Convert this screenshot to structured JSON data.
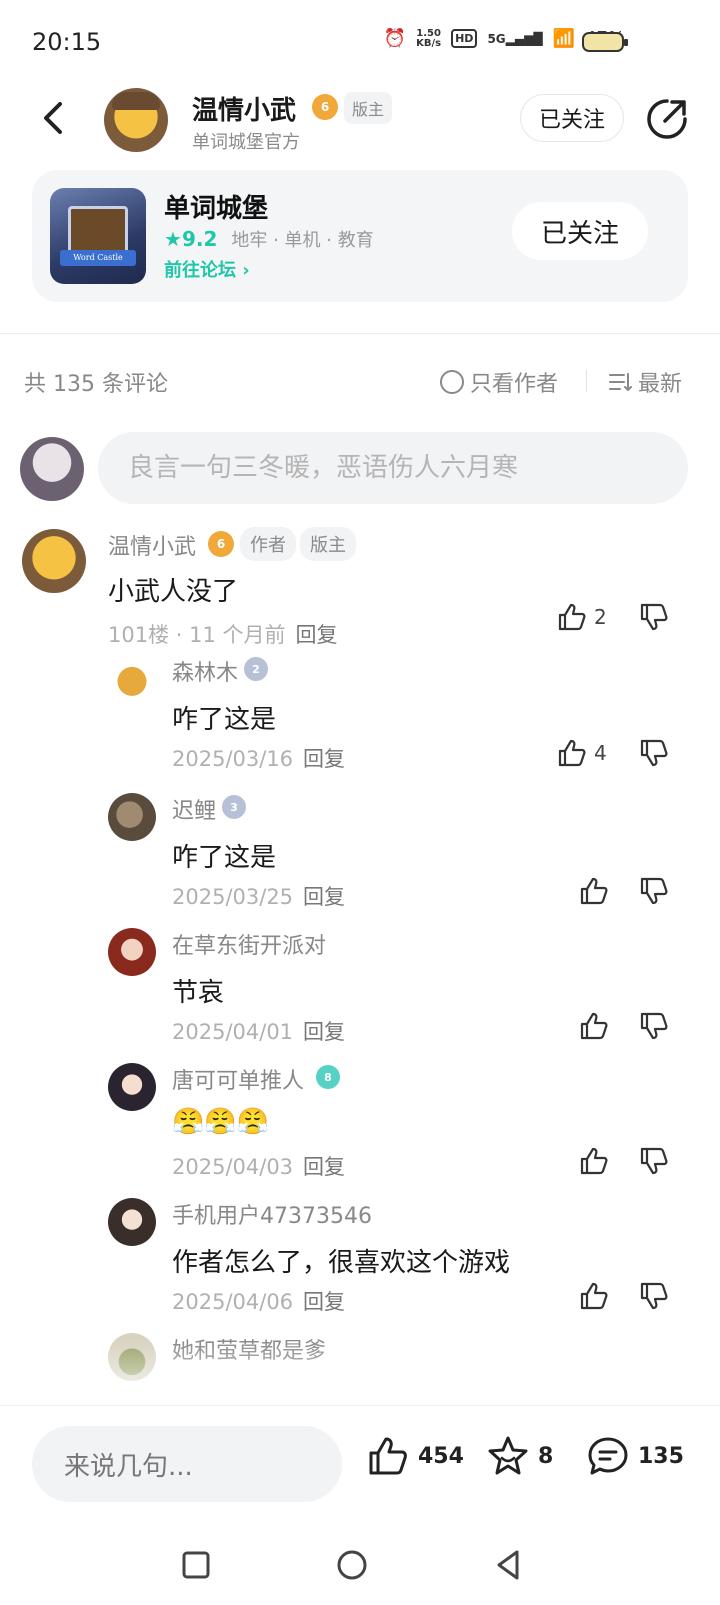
{
  "status_bar": {
    "time": "20:15",
    "net_speed_value": "1.50",
    "net_speed_unit": "KB/s",
    "hd": "HD",
    "signal": "5G",
    "battery": "47%"
  },
  "header": {
    "author_name": "温情小武",
    "author_level": "6",
    "moderator_tag": "版主",
    "author_subtitle": "单词城堡官方",
    "follow_label": "已关注"
  },
  "game_card": {
    "icon_caption": "Word Castle",
    "title": "单词城堡",
    "rating": "9.2",
    "tags": "地牢 · 单机 · 教育",
    "forum_link": "前往论坛",
    "follow_label": "已关注"
  },
  "comments_header": {
    "count_label": "共 135 条评论",
    "author_only": "只看作者",
    "sort": "最新"
  },
  "comment_input": {
    "placeholder": "良言一句三冬暖，恶语伤人六月寒"
  },
  "main_comment": {
    "name": "温情小武",
    "level": "6",
    "tag_author": "作者",
    "tag_mod": "版主",
    "text": "小武人没了",
    "meta": "101楼 · 11 个月前",
    "reply": "回复",
    "likes": "2"
  },
  "replies": [
    {
      "name": "森林木",
      "level": "2",
      "text": "咋了这是",
      "date": "2025/03/16",
      "reply": "回复",
      "likes": "4"
    },
    {
      "name": "迟鲤",
      "level": "3",
      "text": "咋了这是",
      "date": "2025/03/25",
      "reply": "回复",
      "likes": ""
    },
    {
      "name": "在草东街开派对",
      "level": "",
      "text": "节哀",
      "date": "2025/04/01",
      "reply": "回复",
      "likes": ""
    },
    {
      "name": "唐可可单推人",
      "level": "8",
      "text": "😤😤😤",
      "date": "2025/04/03",
      "reply": "回复",
      "likes": ""
    },
    {
      "name": "手机用户47373546",
      "level": "",
      "text": "作者怎么了，很喜欢这个游戏",
      "date": "2025/04/06",
      "reply": "回复",
      "likes": ""
    },
    {
      "name": "她和萤草都是爹"
    }
  ],
  "bottom_bar": {
    "say_placeholder": "来说几句...",
    "likes": "454",
    "favorites": "8",
    "comments": "135"
  },
  "colors": {
    "accent": "#1fc7a8",
    "level_gold": "#f0a83a",
    "level_gray": "#b8c0d8",
    "level_teal": "#57d0c6"
  },
  "icons": [
    "back-icon",
    "share-icon",
    "star-icon",
    "chevron-right-icon",
    "circle-icon",
    "sort-icon",
    "thumb-up-icon",
    "thumb-down-icon",
    "star-outline-icon",
    "comment-bubble-icon",
    "square-icon",
    "circle-home-icon",
    "triangle-back-icon"
  ]
}
